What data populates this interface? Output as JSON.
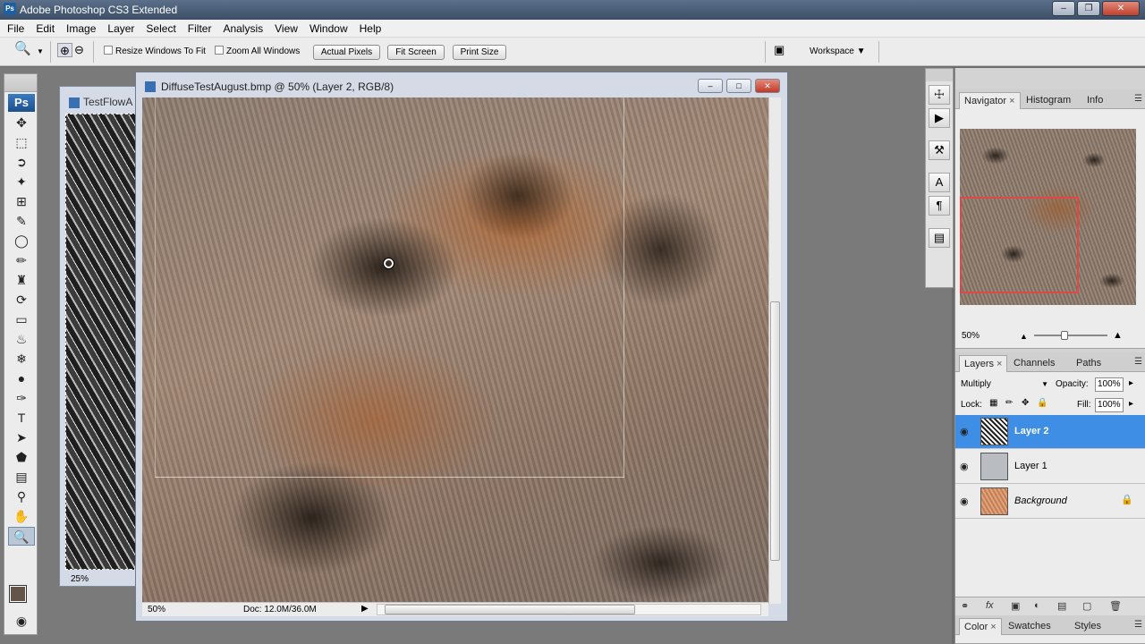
{
  "window": {
    "title": "Adobe Photoshop CS3 Extended",
    "app_icon": "Ps"
  },
  "menu": [
    "File",
    "Edit",
    "Image",
    "Layer",
    "Select",
    "Filter",
    "Analysis",
    "View",
    "Window",
    "Help"
  ],
  "options": {
    "resize_label": "Resize Windows To Fit",
    "zoom_all_label": "Zoom All Windows",
    "actual_pixels": "Actual Pixels",
    "fit_screen": "Fit Screen",
    "print_size": "Print Size",
    "workspace": "Workspace"
  },
  "toolbox": {
    "logo": "Ps"
  },
  "bg_doc": {
    "title": "TestFlowA",
    "zoom": "25%"
  },
  "doc": {
    "title": "DiffuseTestAugust.bmp @ 50% (Layer 2, RGB/8)",
    "zoom": "50%",
    "doc_size": "Doc: 12.0M/36.0M"
  },
  "navigator": {
    "tabs": [
      "Navigator",
      "Histogram",
      "Info"
    ],
    "zoom": "50%"
  },
  "layers": {
    "tabs": [
      "Layers",
      "Channels",
      "Paths"
    ],
    "blend_mode": "Multiply",
    "opacity_label": "Opacity:",
    "opacity": "100%",
    "lock_label": "Lock:",
    "fill_label": "Fill:",
    "fill": "100%",
    "items": [
      {
        "name": "Layer 2",
        "selected": true
      },
      {
        "name": "Layer 1",
        "selected": false
      },
      {
        "name": "Background",
        "selected": false,
        "locked": true
      }
    ]
  },
  "color_panel": {
    "tabs": [
      "Color",
      "Swatches",
      "Styles"
    ]
  },
  "colors": {
    "selection": "#3d8ee4",
    "navigator_box": "#e04848",
    "foreground": "#63554a",
    "background": "#111111"
  }
}
